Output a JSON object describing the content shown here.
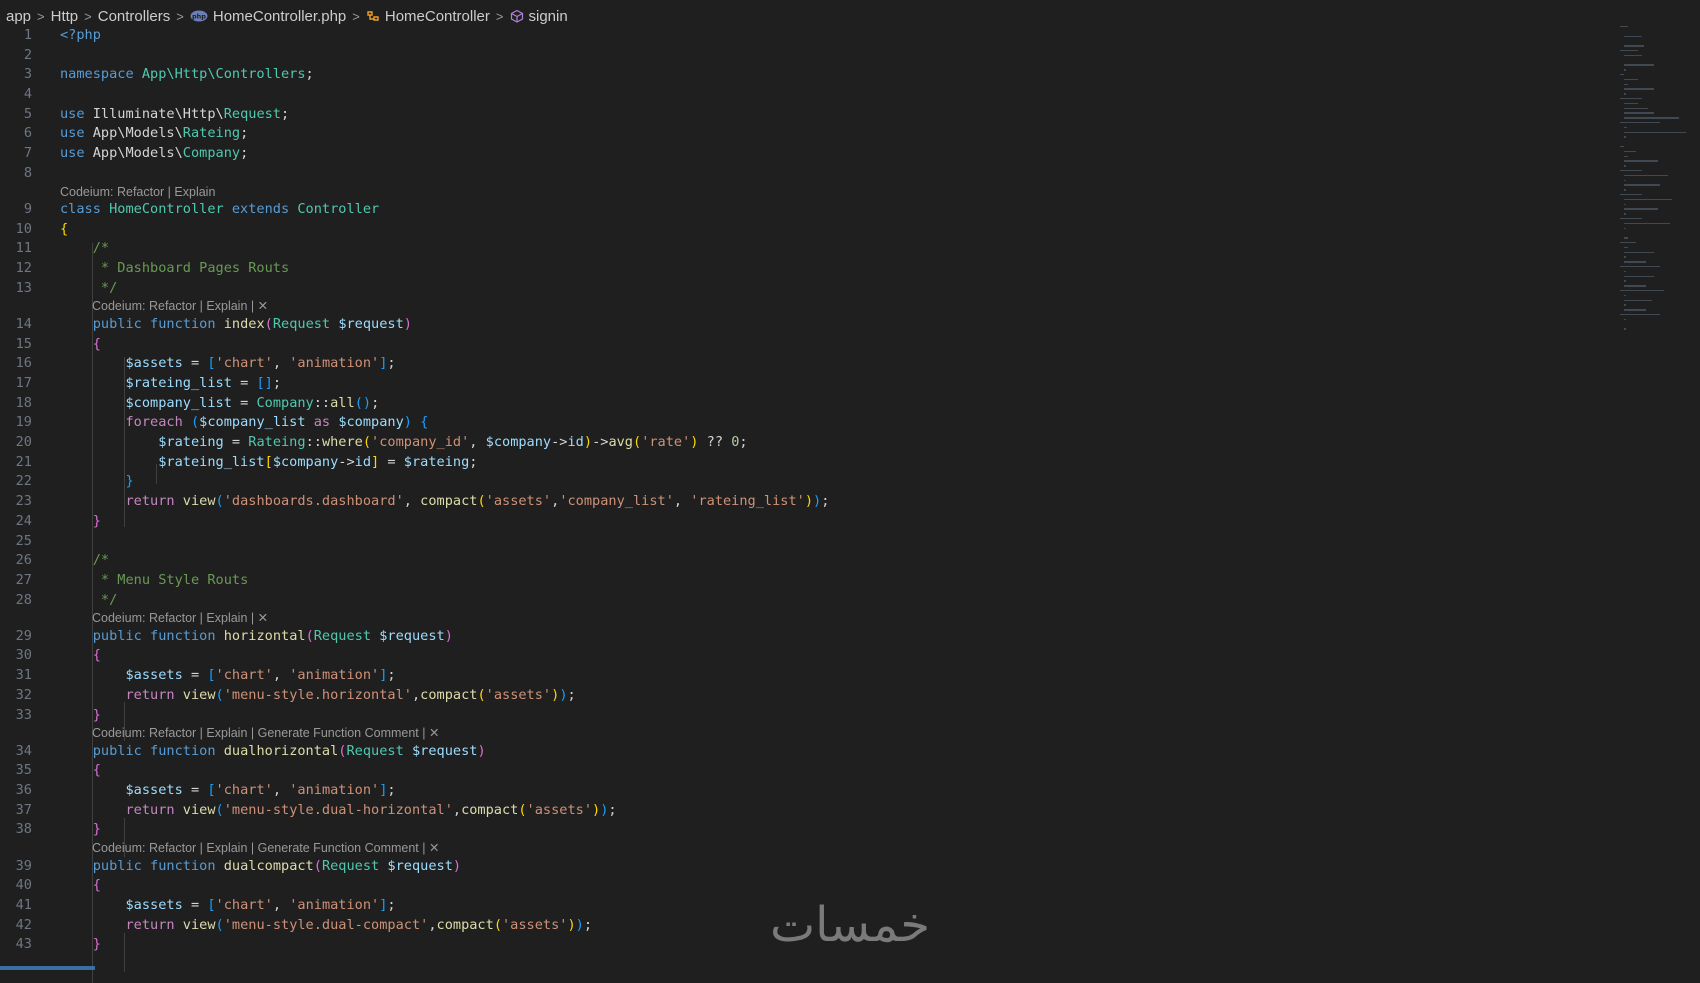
{
  "breadcrumb": {
    "items": [
      "app",
      "Http",
      "Controllers",
      "HomeController.php",
      "HomeController",
      "signin"
    ],
    "separator": ">"
  },
  "codelens": {
    "basic": "Codeium: Refactor | Explain",
    "basic_close": "Codeium: Refactor | Explain | ✕",
    "full_close": "Codeium: Refactor | Explain | Generate Function Comment | ✕"
  },
  "watermark": "خمسات",
  "colors": {
    "background": "#1f1f1f",
    "keyword": "#569cd6",
    "control": "#c586c0",
    "type": "#4ec9b0",
    "function": "#dcdcaa",
    "variable": "#9cdcfe",
    "string": "#ce9178",
    "comment": "#6a9955"
  },
  "code": {
    "l1": "<?php",
    "l3_ns": "namespace",
    "l3_path": "App\\Http\\Controllers",
    "l5_pre": "Illuminate\\Http\\",
    "l5_cls": "Request",
    "l6_pre": "App\\Models\\",
    "l6_cls": "Rateing",
    "l7_pre": "App\\Models\\",
    "l7_cls": "Company",
    "use": "use",
    "class": "class",
    "extends": "extends",
    "class_name": "HomeController",
    "parent": "Controller",
    "c1_open": "/*",
    "c1_body": " * Dashboard Pages Routs",
    "c1_close": " */",
    "c2_body": " * Menu Style Routs",
    "public": "public",
    "function": "function",
    "fn_index": "index",
    "fn_horizontal": "horizontal",
    "fn_dualhorizontal": "dualhorizontal",
    "fn_dualcompact": "dualcompact",
    "param_type": "Request",
    "param_var": "$request",
    "assets": "$assets",
    "str_chart": "'chart'",
    "str_animation": "'animation'",
    "rateing_list": "$rateing_list",
    "company_list": "$company_list",
    "company_cls": "Company",
    "all": "all",
    "foreach": "foreach",
    "as": "as",
    "company": "$company",
    "rateing": "$rateing",
    "rateing_cls": "Rateing",
    "where": "where",
    "str_company_id": "'company_id'",
    "id": "id",
    "avg": "avg",
    "str_rate": "'rate'",
    "zero": "0",
    "return": "return",
    "view": "view",
    "compact": "compact",
    "str_dashboard": "'dashboards.dashboard'",
    "str_assets": "'assets'",
    "str_company_list": "'company_list'",
    "str_rateing_list": "'rateing_list'",
    "str_horizontal": "'menu-style.horizontal'",
    "str_dual_horizontal": "'menu-style.dual-horizontal'",
    "str_dual_compact": "'menu-style.dual-compact'"
  }
}
